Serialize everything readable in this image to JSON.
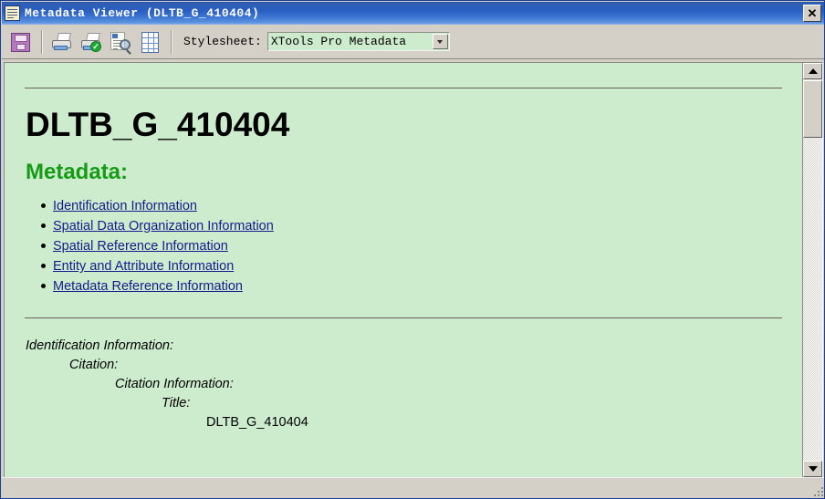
{
  "window": {
    "title": "Metadata Viewer (DLTB_G_410404)",
    "app_icon": "document-icon",
    "close_label": "✕"
  },
  "toolbar": {
    "buttons": [
      {
        "name": "save-button",
        "icon": "floppy-disk-icon",
        "tooltip": "Save"
      },
      {
        "name": "print-button",
        "icon": "printer-icon",
        "tooltip": "Print"
      },
      {
        "name": "print-approve-button",
        "icon": "printer-check-icon",
        "tooltip": "Print"
      },
      {
        "name": "print-preview-button",
        "icon": "document-magnifier-icon",
        "tooltip": "Print Preview"
      },
      {
        "name": "table-view-button",
        "icon": "table-grid-icon",
        "tooltip": "Table"
      }
    ],
    "stylesheet_label": "Stylesheet:",
    "stylesheet_value": "XTools Pro Metadata",
    "stylesheet_options": [
      "XTools Pro Metadata"
    ]
  },
  "document": {
    "title": "DLTB_G_410404",
    "subtitle": "Metadata:",
    "links": [
      "Identification Information",
      "Spatial Data Organization Information",
      "Spatial Reference Information",
      "Entity and Attribute Information",
      "Metadata Reference Information"
    ],
    "detail_rows": [
      {
        "text": "Identification Information:",
        "indent": 0,
        "style": "label"
      },
      {
        "text": "Citation:",
        "indent": 1,
        "style": "label"
      },
      {
        "text": "Citation Information:",
        "indent": 2,
        "style": "label"
      },
      {
        "text": "Title:",
        "indent": 3,
        "style": "label"
      },
      {
        "text": "DLTB_G_410404",
        "indent": 4,
        "style": "value"
      }
    ]
  },
  "colors": {
    "page_background": "#cdeccd",
    "heading_text": "#000000",
    "subtitle_text": "#169b16",
    "link_text": "#151b8d",
    "chrome": "#d4d0c8",
    "titlebar_start": "#2b58a8",
    "titlebar_end": "#8fb6ea",
    "rule": "#6b6056"
  },
  "scrollbar": {
    "up_arrow": "triangle-up-icon",
    "down_arrow": "triangle-down-icon",
    "orientation": "vertical"
  },
  "statusbar": {
    "resize_grip": "resize-grip-icon"
  }
}
